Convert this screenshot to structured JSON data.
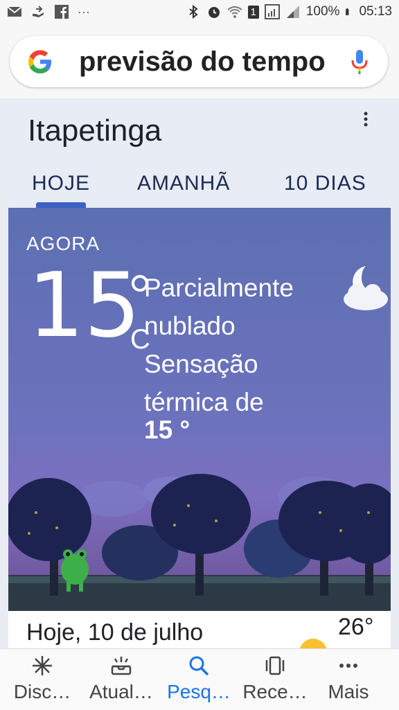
{
  "statusbar": {
    "battery": "100%",
    "time": "05:13",
    "sim_badge": "1",
    "more": "···"
  },
  "search": {
    "query": "previsão do tempo"
  },
  "weather": {
    "location": "Itapetinga",
    "tabs": [
      "HOJE",
      "AMANHÃ",
      "10 DIAS"
    ],
    "now_label": "AGORA",
    "temperature": "15",
    "unit": "C",
    "condition": "Parcialmente nublado",
    "feels_like_label": "Sensação térmica de",
    "feels_like_value": "15 °",
    "icon": "moon-cloud-icon"
  },
  "forecast": {
    "date": "Hoje, 10 de julho",
    "high": "26°"
  },
  "bottom_nav": {
    "items": [
      {
        "label": "Disc…",
        "icon": "discover-icon"
      },
      {
        "label": "Atual…",
        "icon": "updates-icon"
      },
      {
        "label": "Pesq…",
        "icon": "search-icon"
      },
      {
        "label": "Rece…",
        "icon": "recent-icon"
      },
      {
        "label": "Mais",
        "icon": "more-icon"
      }
    ],
    "active_color": "#1a73e8"
  }
}
